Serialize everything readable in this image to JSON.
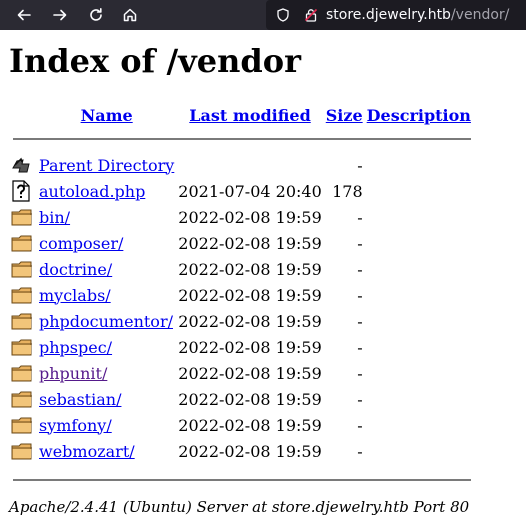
{
  "browser": {
    "url_host": "store.djewelry.htb",
    "url_path": "/vendor/"
  },
  "page": {
    "title": "Index of /vendor",
    "columns": {
      "name": "Name",
      "last_modified": "Last modified",
      "size": "Size",
      "description": "Description"
    },
    "parent": {
      "label": "Parent Directory",
      "size": "-"
    },
    "entries": [
      {
        "name": "autoload.php",
        "date": "2021-07-04 20:40",
        "size": "178",
        "type": "file",
        "visited": false
      },
      {
        "name": "bin/",
        "date": "2022-02-08 19:59",
        "size": "-",
        "type": "folder",
        "visited": false
      },
      {
        "name": "composer/",
        "date": "2022-02-08 19:59",
        "size": "-",
        "type": "folder",
        "visited": false
      },
      {
        "name": "doctrine/",
        "date": "2022-02-08 19:59",
        "size": "-",
        "type": "folder",
        "visited": false
      },
      {
        "name": "myclabs/",
        "date": "2022-02-08 19:59",
        "size": "-",
        "type": "folder",
        "visited": false
      },
      {
        "name": "phpdocumentor/",
        "date": "2022-02-08 19:59",
        "size": "-",
        "type": "folder",
        "visited": false
      },
      {
        "name": "phpspec/",
        "date": "2022-02-08 19:59",
        "size": "-",
        "type": "folder",
        "visited": false
      },
      {
        "name": "phpunit/",
        "date": "2022-02-08 19:59",
        "size": "-",
        "type": "folder",
        "visited": true
      },
      {
        "name": "sebastian/",
        "date": "2022-02-08 19:59",
        "size": "-",
        "type": "folder",
        "visited": false
      },
      {
        "name": "symfony/",
        "date": "2022-02-08 19:59",
        "size": "-",
        "type": "folder",
        "visited": false
      },
      {
        "name": "webmozart/",
        "date": "2022-02-08 19:59",
        "size": "-",
        "type": "folder",
        "visited": false
      }
    ],
    "footer": "Apache/2.4.41 (Ubuntu) Server at store.djewelry.htb Port 80"
  },
  "colors": {
    "link": "#0000ee",
    "visited_link": "#551a8b",
    "toolbar_bg": "#2b2a33",
    "urlbar_bg": "#1c1b22"
  }
}
